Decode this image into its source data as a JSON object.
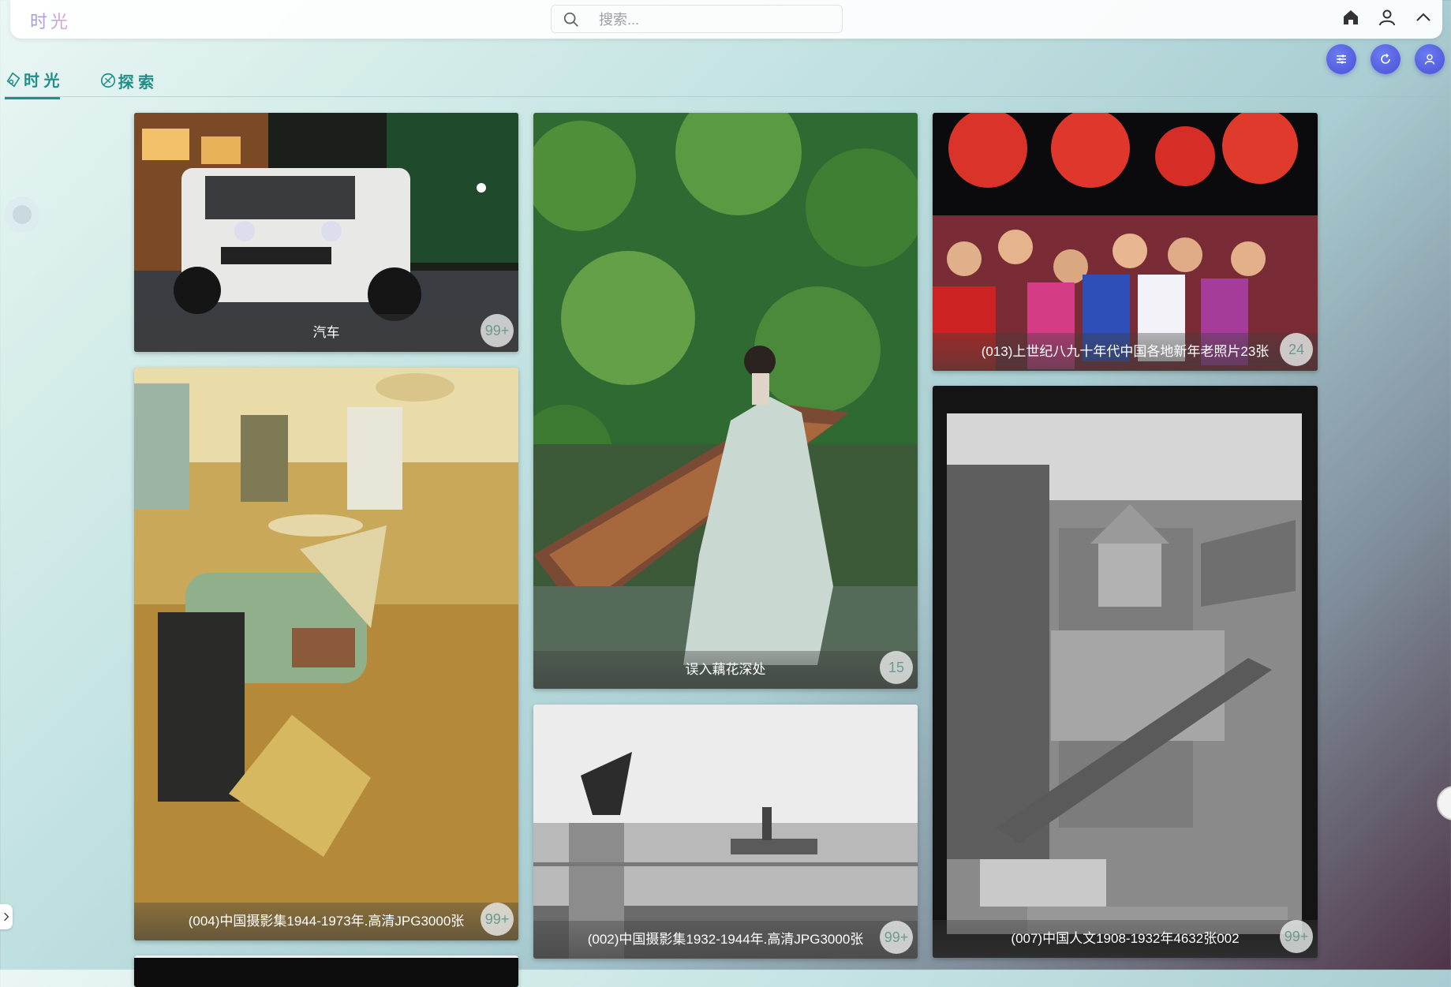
{
  "app": {
    "logo": "时光"
  },
  "search": {
    "placeholder": "搜索..."
  },
  "top_icons": [
    "home-icon",
    "user-icon",
    "chevron-up-icon"
  ],
  "round_buttons": [
    "filter-icon",
    "refresh-icon",
    "profile-icon"
  ],
  "tabs": [
    {
      "label": "时 光",
      "active": true,
      "icon": "time-icon"
    },
    {
      "label": "探 索",
      "active": false,
      "icon": "explore-icon"
    }
  ],
  "cards": [
    {
      "title": "汽车",
      "count": "99+"
    },
    {
      "title": "误入藕花深处",
      "count": "15"
    },
    {
      "title": "(013)上世纪八九十年代中国各地新年老照片23张",
      "count": "24"
    },
    {
      "title": "(004)中国摄影集1944-1973年.高清JPG3000张",
      "count": "99+"
    },
    {
      "title": "(002)中国摄影集1932-1944年.高清JPG3000张",
      "count": "99+"
    },
    {
      "title": "(007)中国人文1908-1932年4632张002",
      "count": "99+"
    }
  ]
}
